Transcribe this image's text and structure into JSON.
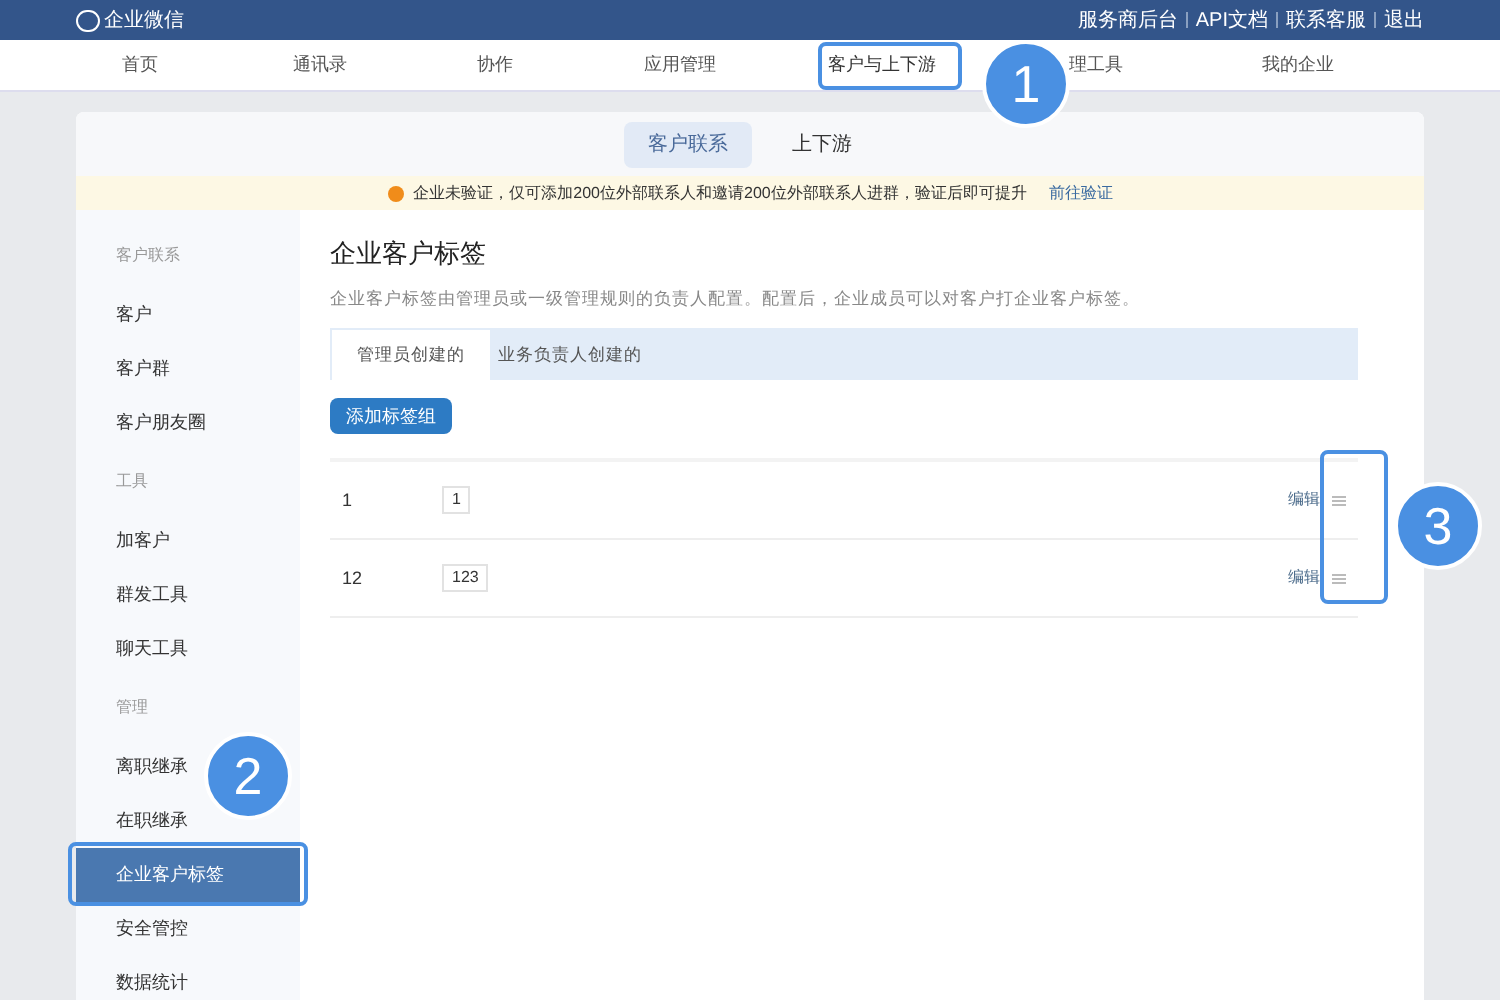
{
  "topbar": {
    "logo": "企业微信",
    "links": [
      "服务商后台",
      "API文档",
      "联系客服",
      "退出"
    ]
  },
  "nav": [
    {
      "label": "首页",
      "selected": false
    },
    {
      "label": "通讯录",
      "selected": false
    },
    {
      "label": "协作",
      "selected": false
    },
    {
      "label": "应用管理",
      "selected": false
    },
    {
      "label": "客户与上下游",
      "selected": true
    },
    {
      "label": "理工具",
      "selected": false
    },
    {
      "label": "我的企业",
      "selected": false
    }
  ],
  "subtabs": [
    {
      "label": "客户联系",
      "selected": true
    },
    {
      "label": "上下游",
      "selected": false
    }
  ],
  "notice": {
    "text": "企业未验证，仅可添加200位外部联系人和邀请200位外部联系人进群，验证后即可提升",
    "link": "前往验证"
  },
  "sidebar": [
    {
      "kind": "heading",
      "label": "客户联系"
    },
    {
      "kind": "item",
      "label": "客户",
      "selected": false
    },
    {
      "kind": "item",
      "label": "客户群",
      "selected": false
    },
    {
      "kind": "item",
      "label": "客户朋友圈",
      "selected": false
    },
    {
      "kind": "heading",
      "label": "工具"
    },
    {
      "kind": "item",
      "label": "加客户",
      "selected": false
    },
    {
      "kind": "item",
      "label": "群发工具",
      "selected": false
    },
    {
      "kind": "item",
      "label": "聊天工具",
      "selected": false
    },
    {
      "kind": "heading",
      "label": "管理"
    },
    {
      "kind": "item",
      "label": "离职继承",
      "selected": false
    },
    {
      "kind": "item",
      "label": "在职继承",
      "selected": false
    },
    {
      "kind": "item",
      "label": "企业客户标签",
      "selected": true
    },
    {
      "kind": "item",
      "label": "安全管控",
      "selected": false
    },
    {
      "kind": "item",
      "label": "数据统计",
      "selected": false
    }
  ],
  "content": {
    "title": "企业客户标签",
    "description": "企业客户标签由管理员或一级管理规则的负责人配置。配置后，企业成员可以对客户打企业客户标签。",
    "tabs": [
      {
        "label": "管理员创建的",
        "selected": true
      },
      {
        "label": "业务负责人创建的",
        "selected": false
      }
    ],
    "add_button": "添加标签组",
    "groups": [
      {
        "name": "1",
        "tag": "1",
        "action": "编辑"
      },
      {
        "name": "12",
        "tag": "123",
        "action": "编辑"
      }
    ]
  },
  "callouts": [
    "1",
    "2",
    "3"
  ]
}
